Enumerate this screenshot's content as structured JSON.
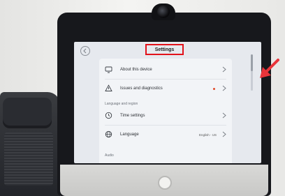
{
  "screen": {
    "title": "Settings",
    "items": [
      {
        "label": "About this device",
        "icon": "monitor-icon"
      },
      {
        "label": "Issues and diagnostics",
        "icon": "warning-icon",
        "status_dot": true
      }
    ],
    "section_language": "Language and region",
    "language_items": [
      {
        "label": "Time settings",
        "icon": "clock-icon"
      },
      {
        "label": "Language",
        "icon": "globe-icon",
        "value": "English - US"
      }
    ],
    "section_audio": "Audio"
  },
  "colors": {
    "highlight_box": "#e2121b",
    "annotation_arrow": "#e8343a",
    "status_dot": "#e04a2a"
  }
}
